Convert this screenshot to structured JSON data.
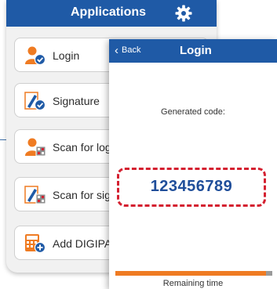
{
  "applications": {
    "title": "Applications",
    "items": [
      {
        "label": "Login",
        "icon": "user-check-icon"
      },
      {
        "label": "Signature",
        "icon": "pen-check-icon"
      },
      {
        "label": "Scan for logi",
        "icon": "user-scan-icon"
      },
      {
        "label": "Scan for sigr",
        "icon": "pen-scan-icon"
      },
      {
        "label": "Add DIGIPAS",
        "icon": "calculator-add-icon"
      }
    ],
    "settings_icon": "gear-icon",
    "colors": {
      "header": "#1f5aa6",
      "orange": "#ef7b22",
      "blue": "#1f5aa6"
    }
  },
  "login_screen": {
    "back_label": "Back",
    "title": "Login",
    "generated_label": "Generated code:",
    "code": "123456789",
    "remaining_label": "Remaining time",
    "remaining_fraction": 0.96,
    "colors": {
      "code": "#1f4e9a",
      "dashed_border": "#d42030",
      "progress": "#ef7b22"
    }
  }
}
